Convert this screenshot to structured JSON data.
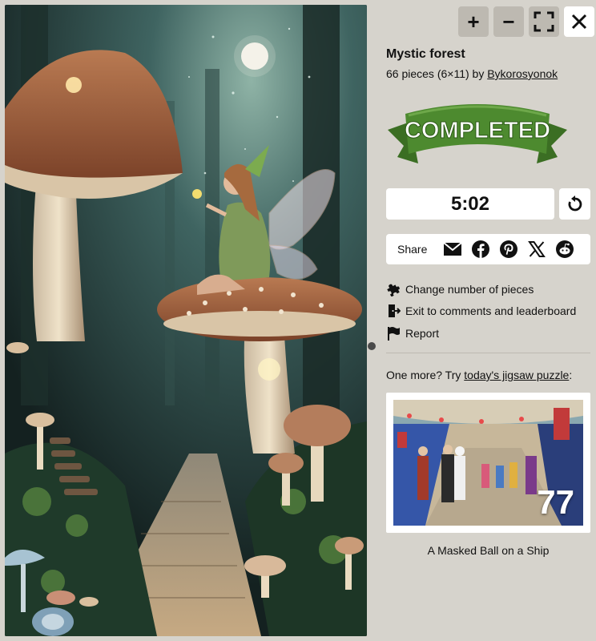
{
  "toolbar": {
    "zoom_in": "+",
    "zoom_out": "−",
    "fullscreen_icon": "fullscreen-icon",
    "close_icon": "close-icon"
  },
  "puzzle": {
    "title": "Mystic forest",
    "pieces_text": "66 pieces (6×11) by ",
    "author": "Bykorosyonok"
  },
  "status_badge": "COMPLETED",
  "timer": "5:02",
  "share": {
    "label": "Share",
    "icons": [
      "mail-icon",
      "facebook-icon",
      "pinterest-icon",
      "x-icon",
      "reddit-icon"
    ]
  },
  "actions": [
    {
      "label": "Change number of pieces",
      "icon": "puzzle-piece-icon"
    },
    {
      "label": "Exit to comments and leaderboard",
      "icon": "exit-icon"
    },
    {
      "label": "Report",
      "icon": "flag-icon"
    }
  ],
  "one_more": {
    "prefix": "One more? Try ",
    "link": "today's jigsaw puzzle",
    "suffix": ":"
  },
  "next_puzzle": {
    "title": "A Masked Ball on a Ship",
    "pieces": "77"
  },
  "colors": {
    "background": "#d6d3cc",
    "ribbon_green": "#4d8a2f",
    "button_gray": "#bdb9b1"
  }
}
